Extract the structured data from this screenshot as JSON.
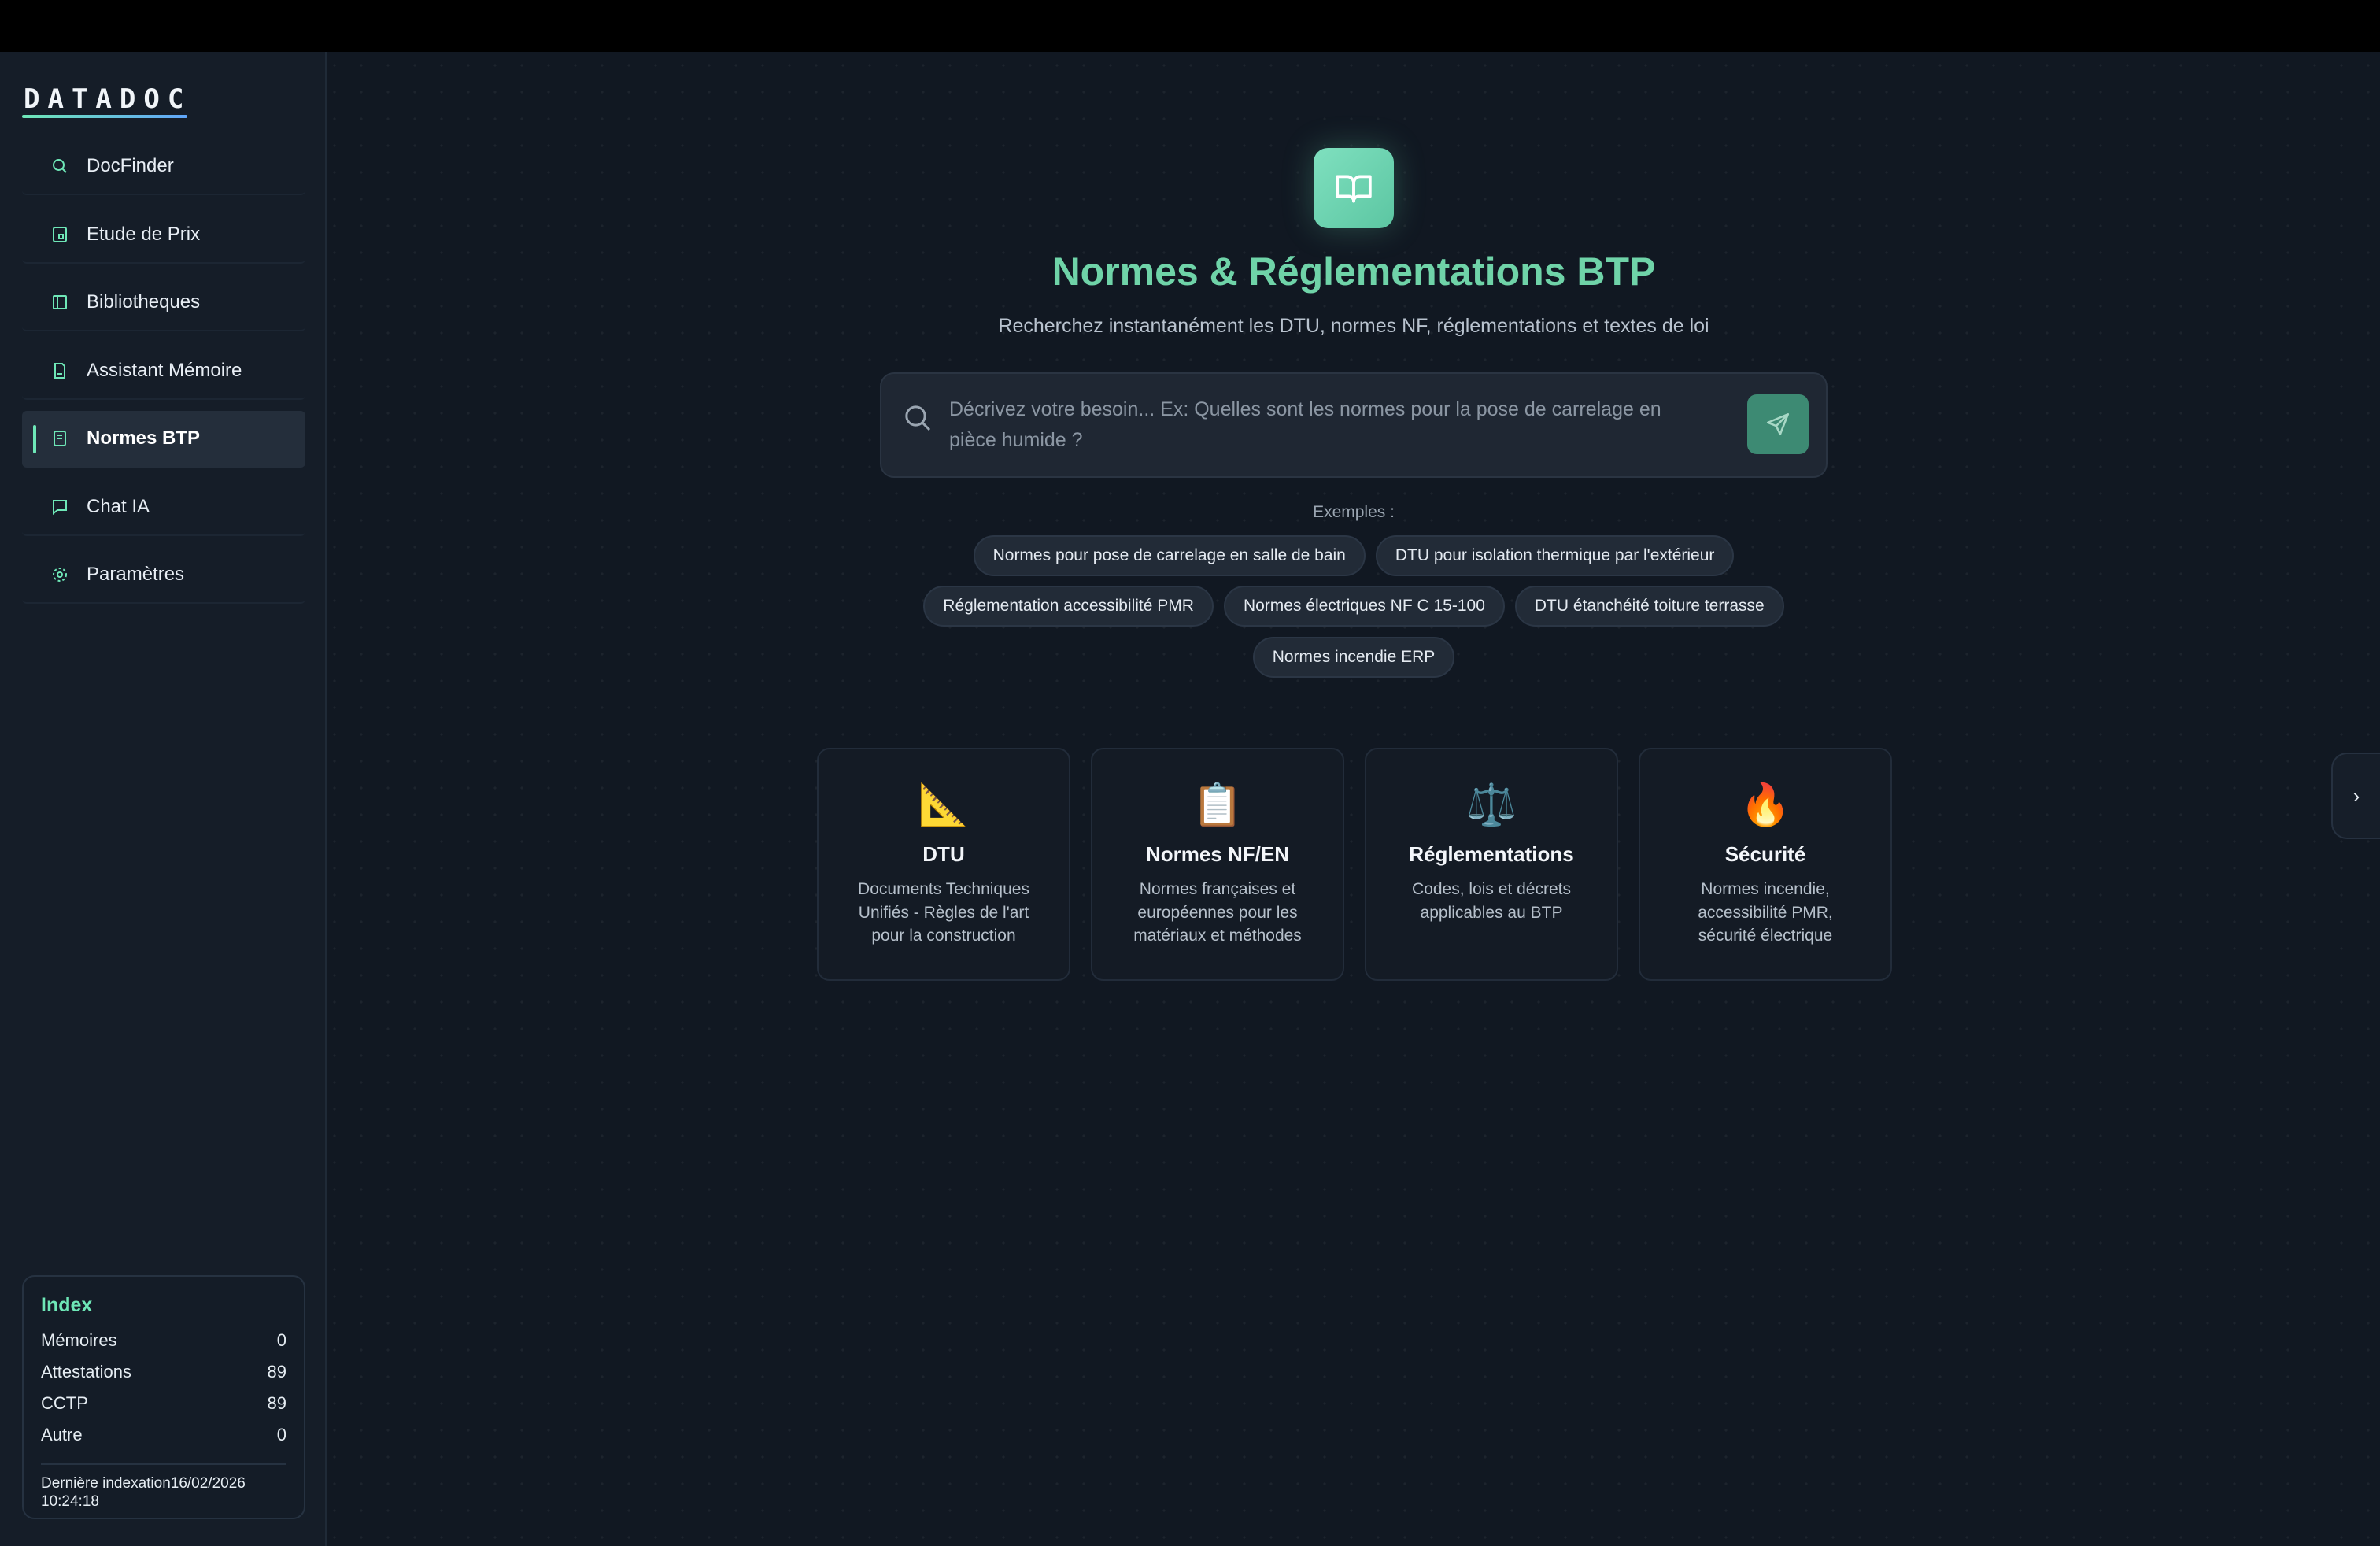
{
  "app": {
    "logo": "DATADOC"
  },
  "sidebar": {
    "items": [
      {
        "label": "DocFinder",
        "icon": "search-icon"
      },
      {
        "label": "Etude de Prix",
        "icon": "calculator-icon"
      },
      {
        "label": "Bibliotheques",
        "icon": "library-icon"
      },
      {
        "label": "Assistant Mémoire",
        "icon": "document-icon"
      },
      {
        "label": "Normes BTP",
        "icon": "book-icon",
        "active": true
      },
      {
        "label": "Chat IA",
        "icon": "chat-icon"
      },
      {
        "label": "Paramètres",
        "icon": "gear-icon"
      }
    ],
    "index": {
      "title": "Index",
      "rows": [
        {
          "label": "Mémoires",
          "value": "0"
        },
        {
          "label": "Attestations",
          "value": "89"
        },
        {
          "label": "CCTP",
          "value": "89"
        },
        {
          "label": "Autre",
          "value": "0"
        }
      ],
      "last_indexed_label": "Dernière indexation",
      "last_indexed_date": "16/02/2026",
      "last_indexed_time": "10:24:18"
    }
  },
  "main": {
    "title": "Normes & Réglementations BTP",
    "subtitle": "Recherchez instantanément les DTU, normes NF, réglementations et textes de loi",
    "search": {
      "placeholder": "Décrivez votre besoin... Ex: Quelles sont les normes pour la pose de carrelage en pièce humide ?",
      "value": ""
    },
    "examples_label": "Exemples :",
    "examples": [
      "Normes pour pose de carrelage en salle de bain",
      "DTU pour isolation thermique par l'extérieur",
      "Réglementation accessibilité PMR",
      "Normes électriques NF C 15-100",
      "DTU étanchéité toiture terrasse",
      "Normes incendie ERP"
    ],
    "cards": [
      {
        "icon": "triangle-ruler-icon",
        "glyph": "📐",
        "title": "DTU",
        "desc": "Documents Techniques Unifiés - Règles de l'art pour la construction"
      },
      {
        "icon": "clipboard-icon",
        "glyph": "📋",
        "title": "Normes NF/EN",
        "desc": "Normes françaises et européennes pour les matériaux et méthodes"
      },
      {
        "icon": "scales-icon",
        "glyph": "⚖️",
        "title": "Réglementations",
        "desc": "Codes, lois et décrets applicables au BTP"
      },
      {
        "icon": "fire-icon",
        "glyph": "🔥",
        "title": "Sécurité",
        "desc": "Normes incendie, accessibilité PMR, sécurité électrique"
      }
    ],
    "panel_toggle": "›"
  },
  "colors": {
    "accent": "#6ee7b7",
    "title": "#6fd3a8",
    "background": "#111822",
    "sidebar": "#151d28"
  }
}
